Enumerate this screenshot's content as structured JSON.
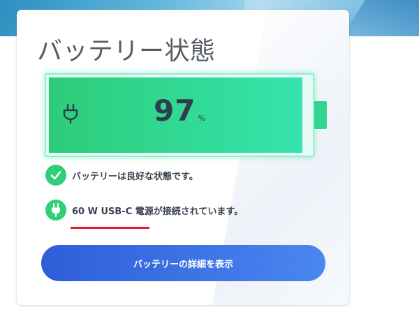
{
  "page": {
    "title": "バッテリー状態"
  },
  "battery": {
    "level_percent": 97,
    "percent_value": "97",
    "percent_sign": "%",
    "fill_color": "#2dcc78",
    "icon": "plug-icon"
  },
  "status": {
    "health": {
      "icon": "check-icon",
      "text": "バッテリーは良好な状態です。"
    },
    "power": {
      "icon": "plug-icon",
      "source": "60 W USB-C 電源",
      "suffix": "が接続されています。"
    }
  },
  "actions": {
    "details_label": "バッテリーの詳細を表示"
  },
  "colors": {
    "accent_green": "#2fcf76",
    "button_blue": "#3a6fe3",
    "highlight_red": "#e0202a"
  }
}
